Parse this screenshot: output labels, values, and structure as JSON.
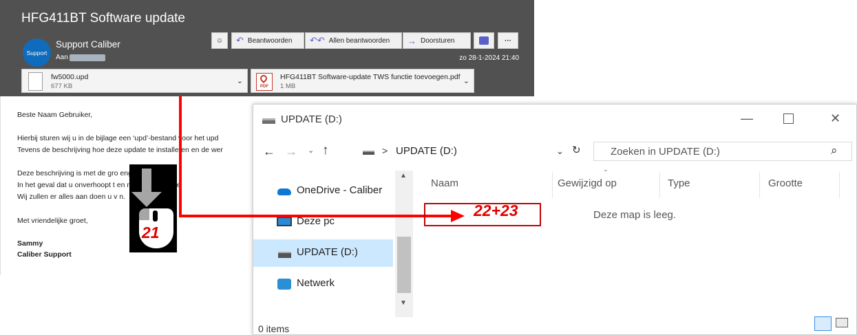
{
  "email": {
    "subject": "HFG411BT Software update",
    "avatar_text": "Support",
    "sender": "Support Caliber",
    "to_label": "Aan",
    "date": "zo 28-1-2024 21:40",
    "toolbar": {
      "reply": "Beantwoorden",
      "reply_all": "Allen beantwoorden",
      "forward": "Doorsturen",
      "more": "···"
    },
    "attachments": [
      {
        "name": "fw5000.upd",
        "size": "677 KB"
      },
      {
        "name": "HFG411BT Software-update TWS functie toevoegen.pdf",
        "size": "1 MB"
      }
    ],
    "body": [
      "Beste Naam Gebruiker,",
      "Hierbij sturen wij u in de bijlage een ‘upd’-bestand voor het upd",
      "Tevens de beschrijving hoe deze update te installeren en de wer",
      "Deze beschrijving is met de gro                     engesteld.",
      "In het geval dat u onverhoopt t                    en met deze update",
      "Wij zullen er alles aan doen u v                  n.",
      "Met vriendelijke groet,",
      "Sammy",
      "Caliber Support"
    ]
  },
  "explorer": {
    "title": "UPDATE (D:)",
    "path_sep": ">",
    "path": "UPDATE (D:)",
    "search_placeholder": "Zoeken in UPDATE (D:)",
    "nav": [
      "OneDrive - Caliber",
      "Deze pc",
      "UPDATE (D:)",
      "Netwerk"
    ],
    "columns": [
      "Naam",
      "Gewijzigd op",
      "Type",
      "Grootte"
    ],
    "empty_message": "Deze map is leeg.",
    "status": "0 items",
    "selected_nav": "UPDATE (D:)"
  },
  "annotations": {
    "step_drag": "21",
    "step_drop": "22+23",
    "arrow_color": "#ff0000"
  }
}
